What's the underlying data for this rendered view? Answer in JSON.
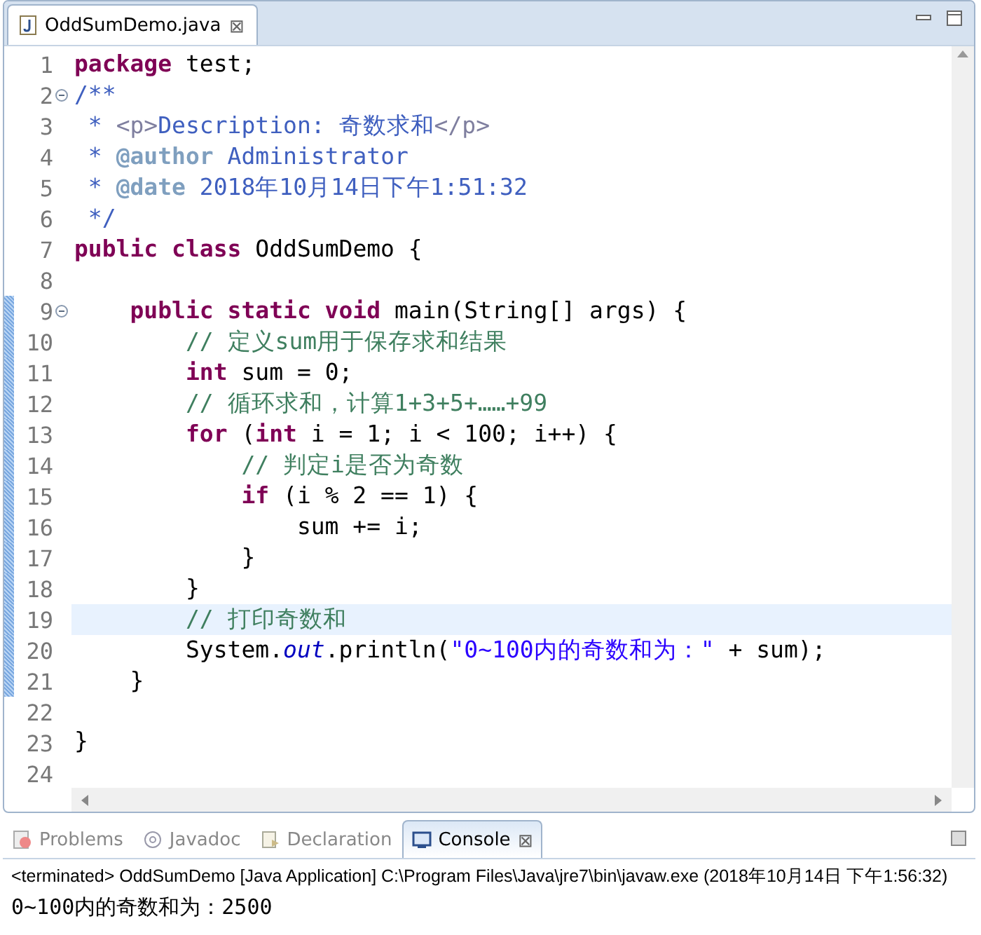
{
  "editor_tab": {
    "title": "OddSumDemo.java",
    "close": "⊠"
  },
  "code_lines": [
    {
      "number": "1",
      "tokens": [
        {
          "kind": "keyword",
          "text": "package"
        },
        {
          "kind": "plain",
          "text": " test;"
        }
      ]
    },
    {
      "number": "2",
      "fold": true,
      "tokens": [
        {
          "kind": "javadoc",
          "text": "/**"
        }
      ]
    },
    {
      "number": "3",
      "tokens": [
        {
          "kind": "javadoc",
          "text": " * "
        },
        {
          "kind": "html",
          "text": "<p>"
        },
        {
          "kind": "javadoc",
          "text": "Description: 奇数求和"
        },
        {
          "kind": "html",
          "text": "</p>"
        }
      ]
    },
    {
      "number": "4",
      "tokens": [
        {
          "kind": "javadoc",
          "text": " * "
        },
        {
          "kind": "jdtag",
          "text": "@author"
        },
        {
          "kind": "javadoc",
          "text": " Administrator"
        }
      ]
    },
    {
      "number": "5",
      "tokens": [
        {
          "kind": "javadoc",
          "text": " * "
        },
        {
          "kind": "jdtag",
          "text": "@date"
        },
        {
          "kind": "javadoc",
          "text": " 2018年10月14日下午1:51:32"
        }
      ]
    },
    {
      "number": "6",
      "tokens": [
        {
          "kind": "javadoc",
          "text": " */"
        }
      ]
    },
    {
      "number": "7",
      "tokens": [
        {
          "kind": "keyword",
          "text": "public class"
        },
        {
          "kind": "plain",
          "text": " OddSumDemo {"
        }
      ]
    },
    {
      "number": "8"
    },
    {
      "number": "9",
      "fold": true,
      "changed": true,
      "tokens": [
        {
          "kind": "keyword",
          "text": "    public static void"
        },
        {
          "kind": "plain",
          "text": " main(String[] args) {"
        }
      ]
    },
    {
      "number": "10",
      "changed": true,
      "tokens": [
        {
          "kind": "comment",
          "text": "        // 定义sum用于保存求和结果"
        }
      ]
    },
    {
      "number": "11",
      "changed": true,
      "tokens": [
        {
          "kind": "keyword",
          "text": "        int"
        },
        {
          "kind": "plain",
          "text": " sum = 0;"
        }
      ]
    },
    {
      "number": "12",
      "changed": true,
      "tokens": [
        {
          "kind": "comment",
          "text": "        // 循环求和，计算1+3+5+……+99"
        }
      ]
    },
    {
      "number": "13",
      "changed": true,
      "tokens": [
        {
          "kind": "keyword",
          "text": "        for"
        },
        {
          "kind": "plain",
          "text": " ("
        },
        {
          "kind": "keyword",
          "text": "int"
        },
        {
          "kind": "plain",
          "text": " i = 1; i < 100; i++) {"
        }
      ]
    },
    {
      "number": "14",
      "changed": true,
      "tokens": [
        {
          "kind": "comment",
          "text": "            // 判定i是否为奇数"
        }
      ]
    },
    {
      "number": "15",
      "changed": true,
      "tokens": [
        {
          "kind": "keyword",
          "text": "            if"
        },
        {
          "kind": "plain",
          "text": " (i % 2 == 1) {"
        }
      ]
    },
    {
      "number": "16",
      "changed": true,
      "tokens": [
        {
          "kind": "plain",
          "text": "                sum += i;"
        }
      ]
    },
    {
      "number": "17",
      "changed": true,
      "tokens": [
        {
          "kind": "plain",
          "text": "            }"
        }
      ]
    },
    {
      "number": "18",
      "changed": true,
      "tokens": [
        {
          "kind": "plain",
          "text": "        }"
        }
      ]
    },
    {
      "number": "19",
      "changed": true,
      "current": true,
      "tokens": [
        {
          "kind": "comment",
          "text": "        // 打印奇数和"
        }
      ]
    },
    {
      "number": "20",
      "changed": true,
      "tokens": [
        {
          "kind": "plain",
          "text": "        System."
        },
        {
          "kind": "field",
          "text": "out"
        },
        {
          "kind": "plain",
          "text": ".println("
        },
        {
          "kind": "string",
          "text": "\"0~100内的奇数和为：\""
        },
        {
          "kind": "plain",
          "text": " + sum);"
        }
      ]
    },
    {
      "number": "21",
      "changed": true,
      "tokens": [
        {
          "kind": "plain",
          "text": "    }"
        }
      ]
    },
    {
      "number": "22"
    },
    {
      "number": "23",
      "tokens": [
        {
          "kind": "plain",
          "text": "}"
        }
      ]
    },
    {
      "number": "24"
    }
  ],
  "bottom_tabs": [
    {
      "label": "Problems",
      "kind": "problems",
      "selected": false
    },
    {
      "label": "Javadoc",
      "kind": "javadoc",
      "selected": false
    },
    {
      "label": "Declaration",
      "kind": "declaration",
      "selected": false
    },
    {
      "label": "Console",
      "kind": "console",
      "selected": true,
      "close": "⊠"
    }
  ],
  "console": {
    "header": "<terminated> OddSumDemo [Java Application] C:\\Program Files\\Java\\jre7\\bin\\javaw.exe (2018年10月14日 下午1:56:32)",
    "output": "0~100内的奇数和为：2500"
  }
}
